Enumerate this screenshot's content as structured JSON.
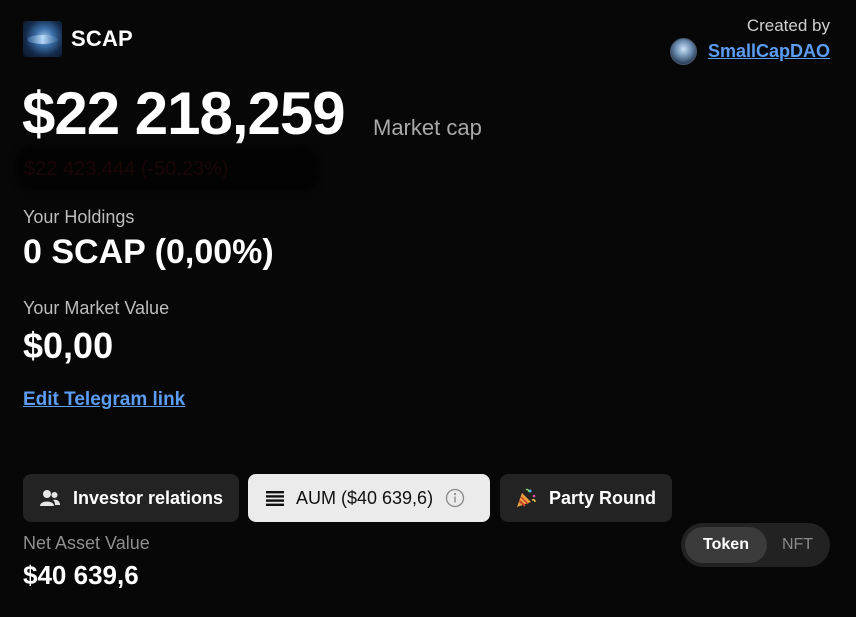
{
  "token": {
    "name": "SCAP",
    "logo_icon": "token-logo-image"
  },
  "creator": {
    "label": "Created by",
    "name": "SmallCapDAO",
    "avatar_icon": "creator-avatar-image"
  },
  "market_cap": {
    "value": "$22 218,259",
    "label": "Market cap",
    "change_obscured": "$22 423,444 (-50,23%)"
  },
  "holdings": {
    "label": "Your Holdings",
    "value": "0 SCAP (0,00%)"
  },
  "market_value": {
    "label": "Your Market Value",
    "value": "$0,00"
  },
  "telegram_link": "Edit Telegram link",
  "tabs": [
    {
      "label": "Investor relations",
      "icon": "users-icon",
      "active": false
    },
    {
      "label": "AUM ($40 639,6)",
      "icon": "list-icon",
      "info_icon": "info-icon",
      "active": true
    },
    {
      "label": "Party Round",
      "icon": "party-popper-icon",
      "active": false
    }
  ],
  "net_asset_value": {
    "label": "Net Asset Value",
    "value": "$40 639,6"
  },
  "view_toggle": {
    "options": [
      "Token",
      "NFT"
    ],
    "selected": "Token"
  },
  "colors": {
    "background": "#070707",
    "link": "#5b9df5",
    "tab_dark": "#232323",
    "tab_active": "#ebebeb"
  }
}
